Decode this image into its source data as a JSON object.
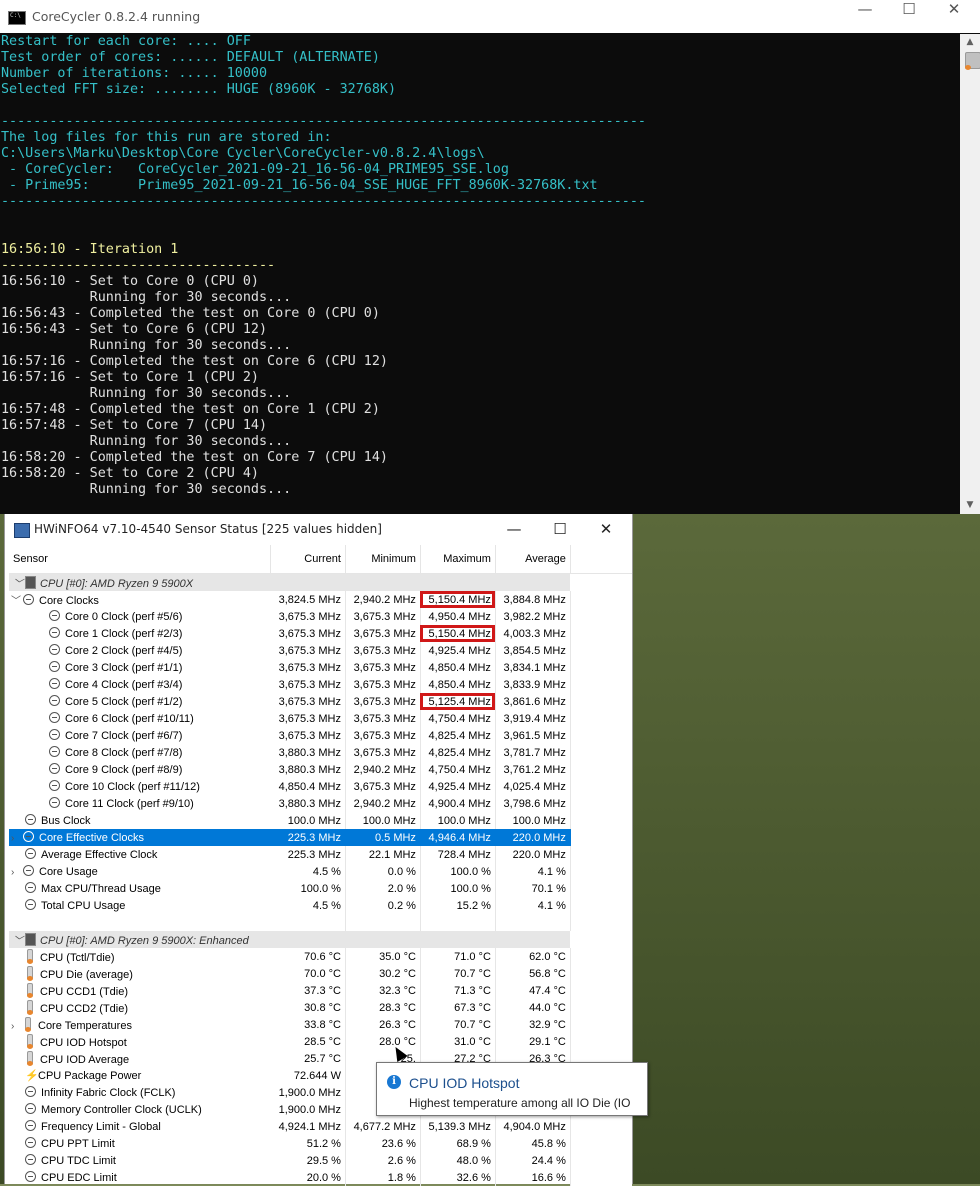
{
  "console": {
    "title": "CoreCycler 0.8.2.4 running",
    "lines": [
      {
        "t": "Restart for each core: .... OFF",
        "c": ""
      },
      {
        "t": "Test order of cores: ...... DEFAULT (ALTERNATE)",
        "c": ""
      },
      {
        "t": "Number of iterations: ..... 10000",
        "c": ""
      },
      {
        "t": "Selected FFT size: ........ HUGE (8960K - 32768K)",
        "c": ""
      },
      {
        "t": "",
        "c": ""
      },
      {
        "t": "--------------------------------------------------------------------------------",
        "c": ""
      },
      {
        "t": "The log files for this run are stored in:",
        "c": ""
      },
      {
        "t": "C:\\Users\\Marku\\Desktop\\Core Cycler\\CoreCycler-v0.8.2.4\\logs\\",
        "c": ""
      },
      {
        "t": " - CoreCycler:   CoreCycler_2021-09-21_16-56-04_PRIME95_SSE.log",
        "c": ""
      },
      {
        "t": " - Prime95:      Prime95_2021-09-21_16-56-04_SSE_HUGE_FFT_8960K-32768K.txt",
        "c": ""
      },
      {
        "t": "--------------------------------------------------------------------------------",
        "c": ""
      },
      {
        "t": "",
        "c": ""
      },
      {
        "t": "",
        "c": ""
      },
      {
        "t": "16:56:10 - Iteration 1",
        "c": "y"
      },
      {
        "t": "----------------------------------",
        "c": "y"
      },
      {
        "t": "16:56:10 - Set to Core 0 (CPU 0)",
        "c": "w"
      },
      {
        "t": "           Running for 30 seconds...",
        "c": "w"
      },
      {
        "t": "16:56:43 - Completed the test on Core 0 (CPU 0)",
        "c": "w"
      },
      {
        "t": "16:56:43 - Set to Core 6 (CPU 12)",
        "c": "w"
      },
      {
        "t": "           Running for 30 seconds...",
        "c": "w"
      },
      {
        "t": "16:57:16 - Completed the test on Core 6 (CPU 12)",
        "c": "w"
      },
      {
        "t": "16:57:16 - Set to Core 1 (CPU 2)",
        "c": "w"
      },
      {
        "t": "           Running for 30 seconds...",
        "c": "w"
      },
      {
        "t": "16:57:48 - Completed the test on Core 1 (CPU 2)",
        "c": "w"
      },
      {
        "t": "16:57:48 - Set to Core 7 (CPU 14)",
        "c": "w"
      },
      {
        "t": "           Running for 30 seconds...",
        "c": "w"
      },
      {
        "t": "16:58:20 - Completed the test on Core 7 (CPU 14)",
        "c": "w"
      },
      {
        "t": "16:58:20 - Set to Core 2 (CPU 4)",
        "c": "w"
      },
      {
        "t": "           Running for 30 seconds...",
        "c": "w"
      }
    ]
  },
  "hwinfo": {
    "title": "HWiNFO64 v7.10-4540 Sensor Status [225 values hidden]",
    "columns": [
      "Sensor",
      "Current",
      "Minimum",
      "Maximum",
      "Average"
    ],
    "rows": [
      {
        "kind": "group",
        "name": "CPU [#0]: AMD Ryzen 9 5900X",
        "exp": "v"
      },
      {
        "level": 1,
        "exp": "v",
        "icon": "clock",
        "name": "Core Clocks",
        "cur": "3,824.5 MHz",
        "min": "2,940.2 MHz",
        "max": "5,150.4 MHz",
        "avg": "3,884.8 MHz",
        "hl": true
      },
      {
        "level": 2,
        "icon": "clock",
        "name": "Core 0 Clock (perf #5/6)",
        "cur": "3,675.3 MHz",
        "min": "3,675.3 MHz",
        "max": "4,950.4 MHz",
        "avg": "3,982.2 MHz"
      },
      {
        "level": 2,
        "icon": "clock",
        "name": "Core 1 Clock (perf #2/3)",
        "cur": "3,675.3 MHz",
        "min": "3,675.3 MHz",
        "max": "5,150.4 MHz",
        "avg": "4,003.3 MHz",
        "hl": true
      },
      {
        "level": 2,
        "icon": "clock",
        "name": "Core 2 Clock (perf #4/5)",
        "cur": "3,675.3 MHz",
        "min": "3,675.3 MHz",
        "max": "4,925.4 MHz",
        "avg": "3,854.5 MHz"
      },
      {
        "level": 2,
        "icon": "clock",
        "name": "Core 3 Clock (perf #1/1)",
        "cur": "3,675.3 MHz",
        "min": "3,675.3 MHz",
        "max": "4,850.4 MHz",
        "avg": "3,834.1 MHz"
      },
      {
        "level": 2,
        "icon": "clock",
        "name": "Core 4 Clock (perf #3/4)",
        "cur": "3,675.3 MHz",
        "min": "3,675.3 MHz",
        "max": "4,850.4 MHz",
        "avg": "3,833.9 MHz"
      },
      {
        "level": 2,
        "icon": "clock",
        "name": "Core 5 Clock (perf #1/2)",
        "cur": "3,675.3 MHz",
        "min": "3,675.3 MHz",
        "max": "5,125.4 MHz",
        "avg": "3,861.6 MHz",
        "hl": true
      },
      {
        "level": 2,
        "icon": "clock",
        "name": "Core 6 Clock (perf #10/11)",
        "cur": "3,675.3 MHz",
        "min": "3,675.3 MHz",
        "max": "4,750.4 MHz",
        "avg": "3,919.4 MHz"
      },
      {
        "level": 2,
        "icon": "clock",
        "name": "Core 7 Clock (perf #6/7)",
        "cur": "3,675.3 MHz",
        "min": "3,675.3 MHz",
        "max": "4,825.4 MHz",
        "avg": "3,961.5 MHz"
      },
      {
        "level": 2,
        "icon": "clock",
        "name": "Core 8 Clock (perf #7/8)",
        "cur": "3,880.3 MHz",
        "min": "3,675.3 MHz",
        "max": "4,825.4 MHz",
        "avg": "3,781.7 MHz"
      },
      {
        "level": 2,
        "icon": "clock",
        "name": "Core 9 Clock (perf #8/9)",
        "cur": "3,880.3 MHz",
        "min": "2,940.2 MHz",
        "max": "4,750.4 MHz",
        "avg": "3,761.2 MHz"
      },
      {
        "level": 2,
        "icon": "clock",
        "name": "Core 10 Clock (perf #11/12)",
        "cur": "4,850.4 MHz",
        "min": "3,675.3 MHz",
        "max": "4,925.4 MHz",
        "avg": "4,025.4 MHz"
      },
      {
        "level": 2,
        "icon": "clock",
        "name": "Core 11 Clock (perf #9/10)",
        "cur": "3,880.3 MHz",
        "min": "2,940.2 MHz",
        "max": "4,900.4 MHz",
        "avg": "3,798.6 MHz"
      },
      {
        "level": 1,
        "icon": "clock",
        "name": "Bus Clock",
        "cur": "100.0 MHz",
        "min": "100.0 MHz",
        "max": "100.0 MHz",
        "avg": "100.0 MHz"
      },
      {
        "level": 1,
        "exp": ">",
        "icon": "clock",
        "name": "Core Effective Clocks",
        "cur": "225.3 MHz",
        "min": "0.5 MHz",
        "max": "4,946.4 MHz",
        "avg": "220.0 MHz",
        "sel": true
      },
      {
        "level": 1,
        "icon": "clock",
        "name": "Average Effective Clock",
        "cur": "225.3 MHz",
        "min": "22.1 MHz",
        "max": "728.4 MHz",
        "avg": "220.0 MHz"
      },
      {
        "level": 1,
        "exp": ">",
        "icon": "clock",
        "name": "Core Usage",
        "cur": "4.5 %",
        "min": "0.0 %",
        "max": "100.0 %",
        "avg": "4.1 %"
      },
      {
        "level": 1,
        "icon": "clock",
        "name": "Max CPU/Thread Usage",
        "cur": "100.0 %",
        "min": "2.0 %",
        "max": "100.0 %",
        "avg": "70.1 %"
      },
      {
        "level": 1,
        "icon": "clock",
        "name": "Total CPU Usage",
        "cur": "4.5 %",
        "min": "0.2 %",
        "max": "15.2 %",
        "avg": "4.1 %"
      },
      {
        "kind": "blank"
      },
      {
        "kind": "group",
        "name": "CPU [#0]: AMD Ryzen 9 5900X: Enhanced",
        "exp": "v"
      },
      {
        "level": 1,
        "icon": "therm",
        "name": "CPU (Tctl/Tdie)",
        "cur": "70.6 °C",
        "min": "35.0 °C",
        "max": "71.0 °C",
        "avg": "62.0 °C"
      },
      {
        "level": 1,
        "icon": "therm",
        "name": "CPU Die (average)",
        "cur": "70.0 °C",
        "min": "30.2 °C",
        "max": "70.7 °C",
        "avg": "56.8 °C"
      },
      {
        "level": 1,
        "icon": "therm",
        "name": "CPU CCD1 (Tdie)",
        "cur": "37.3 °C",
        "min": "32.3 °C",
        "max": "71.3 °C",
        "avg": "47.4 °C"
      },
      {
        "level": 1,
        "icon": "therm",
        "name": "CPU CCD2 (Tdie)",
        "cur": "30.8 °C",
        "min": "28.3 °C",
        "max": "67.3 °C",
        "avg": "44.0 °C"
      },
      {
        "level": 1,
        "exp": ">",
        "icon": "therm",
        "name": "Core Temperatures",
        "cur": "33.8 °C",
        "min": "26.3 °C",
        "max": "70.7 °C",
        "avg": "32.9 °C"
      },
      {
        "level": 1,
        "icon": "therm",
        "name": "CPU IOD Hotspot",
        "cur": "28.5 °C",
        "min": "28.0 °C",
        "max": "31.0 °C",
        "avg": "29.1 °C"
      },
      {
        "level": 1,
        "icon": "therm",
        "name": "CPU IOD Average",
        "cur": "25.7 °C",
        "min": "25.",
        "max": "27.2 °C",
        "avg": "26.3 °C"
      },
      {
        "level": 1,
        "icon": "bolt",
        "name": "CPU Package Power",
        "cur": "72.644 W",
        "min": "33",
        "max": "",
        "avg": ""
      },
      {
        "level": 1,
        "icon": "clock",
        "name": "Infinity Fabric Clock (FCLK)",
        "cur": "1,900.0 MHz",
        "min": "1,900",
        "max": "",
        "avg": ""
      },
      {
        "level": 1,
        "icon": "clock",
        "name": "Memory Controller Clock (UCLK)",
        "cur": "1,900.0 MHz",
        "min": "1,900",
        "max": "",
        "avg": ""
      },
      {
        "level": 1,
        "icon": "clock",
        "name": "Frequency Limit - Global",
        "cur": "4,924.1 MHz",
        "min": "4,677.2 MHz",
        "max": "5,139.3 MHz",
        "avg": "4,904.0 MHz"
      },
      {
        "level": 1,
        "icon": "clock",
        "name": "CPU PPT Limit",
        "cur": "51.2 %",
        "min": "23.6 %",
        "max": "68.9 %",
        "avg": "45.8 %"
      },
      {
        "level": 1,
        "icon": "clock",
        "name": "CPU TDC Limit",
        "cur": "29.5 %",
        "min": "2.6 %",
        "max": "48.0 %",
        "avg": "24.4 %"
      },
      {
        "level": 1,
        "icon": "clock",
        "name": "CPU EDC Limit",
        "cur": "20.0 %",
        "min": "1.8 %",
        "max": "32.6 %",
        "avg": "16.6 %"
      }
    ]
  },
  "tooltip": {
    "icon": "i",
    "title": "CPU IOD Hotspot",
    "desc": "Highest temperature among all IO Die (IO"
  },
  "caption_buttons": {
    "min": "—",
    "max": "☐",
    "close": "✕"
  }
}
